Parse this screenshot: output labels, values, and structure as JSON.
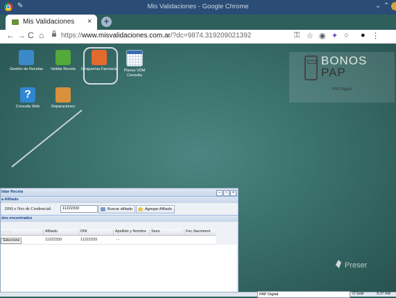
{
  "browser": {
    "window_title": "Mis Validaciones - Google Chrome",
    "tab_title": "Mis Validaciones",
    "url_scheme": "https://",
    "url_host": "www.misvalidaciones.com.ar",
    "url_path": "/?dc=9874.319209021392"
  },
  "desktop": {
    "icons": [
      {
        "label": "Gestión de Recetas",
        "icon": "recetas-icon"
      },
      {
        "label": "Validar Receta",
        "icon": "thumbs-up-icon"
      },
      {
        "label": "Droguerías Farmacia",
        "icon": "folder-icon"
      },
      {
        "label": "Planes VDM Consulta",
        "icon": "calendar-grid-icon"
      },
      {
        "label": "Consulta Web",
        "icon": "help-icon"
      },
      {
        "label": "Reparaciones",
        "icon": "repair-folder-icon"
      }
    ],
    "help_glyph": "?",
    "logo": {
      "line1": "BONOS",
      "line2": "PAP",
      "subtitle": "PAP Digital"
    },
    "watermark": "Preser"
  },
  "dialog": {
    "title": "lidar Receta",
    "section_afiliado": "a Afiliado",
    "dni_label": "DNI o Nro de Credencial:",
    "dni_value": "11222333",
    "search_button": "Buscar afiliado",
    "add_button": "Agregar Afiliado",
    "section_results": "dos encontrados",
    "columns": [
      "Afiliado",
      "DNI",
      "Apellido y Nombre",
      "Sexo",
      "Fec.Nacimient"
    ],
    "row": {
      "select_label": "Seleccione",
      "afiliado": "11222333",
      "dni": "11222333",
      "nombre": "- -"
    }
  },
  "taskbar": {
    "select_value": "PAP Digital",
    "salir_label": "Salir",
    "time": "9:37 AM"
  }
}
